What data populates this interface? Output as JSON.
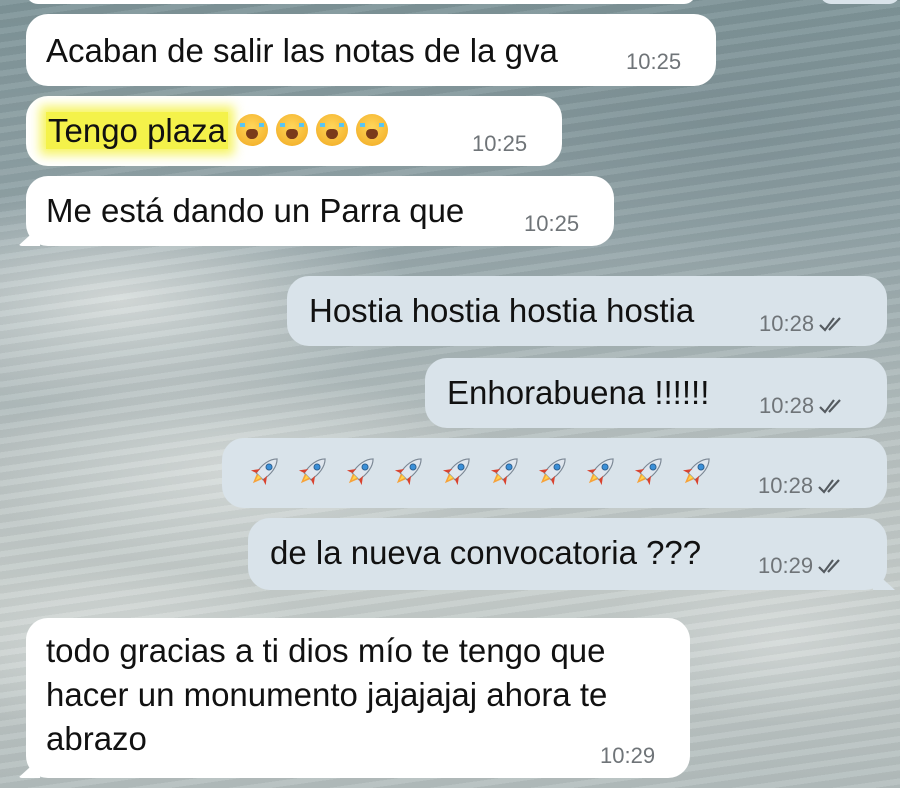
{
  "chat": {
    "messages": [
      {
        "direction": "in",
        "text": "Acaban de salir las notas de la gva",
        "time": "10:25"
      },
      {
        "direction": "in",
        "text_highlight": "Tengo plaza",
        "emoji": "loudly-crying-face-emoji",
        "emoji_count": 4,
        "highlight_color": "#f4f24a",
        "time": "10:25"
      },
      {
        "direction": "in",
        "text": "Me está dando un Parra que",
        "time": "10:25"
      },
      {
        "direction": "out",
        "text": "Hostia hostia hostia hostia",
        "time": "10:28",
        "status": "read"
      },
      {
        "direction": "out",
        "text": "Enhorabuena !!!!!!",
        "time": "10:28",
        "status": "read"
      },
      {
        "direction": "out",
        "emoji": "rocket-emoji",
        "emoji_count": 10,
        "time": "10:28",
        "status": "read"
      },
      {
        "direction": "out",
        "text": "de la nueva convocatoria ???",
        "time": "10:29",
        "status": "read"
      },
      {
        "direction": "in",
        "lines": [
          "todo gracias a ti dios mío te tengo que",
          "hacer un monumento jajajajaj ahora te",
          "abrazo"
        ],
        "time": "10:29"
      }
    ]
  },
  "colors": {
    "incoming_bubble": "#ffffff",
    "outgoing_bubble": "#d9e3ea",
    "timestamp": "#6f7478",
    "highlight": "#f4f24a"
  }
}
